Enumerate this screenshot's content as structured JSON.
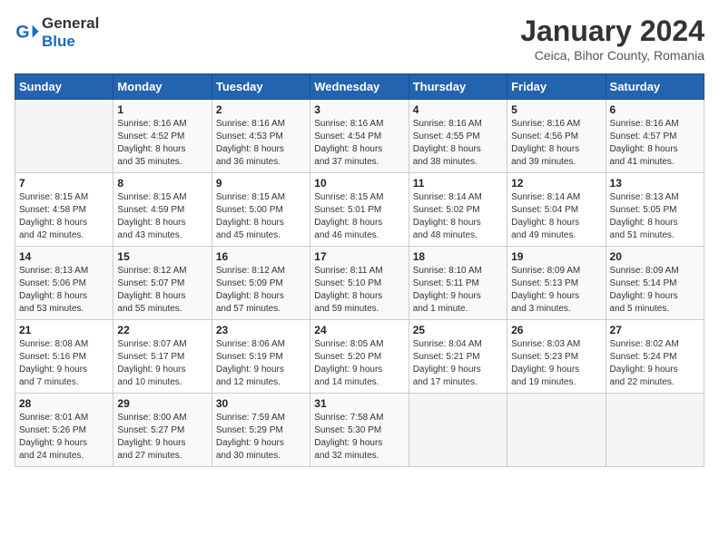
{
  "header": {
    "logo_general": "General",
    "logo_blue": "Blue",
    "title": "January 2024",
    "subtitle": "Ceica, Bihor County, Romania"
  },
  "weekdays": [
    "Sunday",
    "Monday",
    "Tuesday",
    "Wednesday",
    "Thursday",
    "Friday",
    "Saturday"
  ],
  "weeks": [
    [
      {
        "day": "",
        "info": ""
      },
      {
        "day": "1",
        "info": "Sunrise: 8:16 AM\nSunset: 4:52 PM\nDaylight: 8 hours\nand 35 minutes."
      },
      {
        "day": "2",
        "info": "Sunrise: 8:16 AM\nSunset: 4:53 PM\nDaylight: 8 hours\nand 36 minutes."
      },
      {
        "day": "3",
        "info": "Sunrise: 8:16 AM\nSunset: 4:54 PM\nDaylight: 8 hours\nand 37 minutes."
      },
      {
        "day": "4",
        "info": "Sunrise: 8:16 AM\nSunset: 4:55 PM\nDaylight: 8 hours\nand 38 minutes."
      },
      {
        "day": "5",
        "info": "Sunrise: 8:16 AM\nSunset: 4:56 PM\nDaylight: 8 hours\nand 39 minutes."
      },
      {
        "day": "6",
        "info": "Sunrise: 8:16 AM\nSunset: 4:57 PM\nDaylight: 8 hours\nand 41 minutes."
      }
    ],
    [
      {
        "day": "7",
        "info": "Sunrise: 8:15 AM\nSunset: 4:58 PM\nDaylight: 8 hours\nand 42 minutes."
      },
      {
        "day": "8",
        "info": "Sunrise: 8:15 AM\nSunset: 4:59 PM\nDaylight: 8 hours\nand 43 minutes."
      },
      {
        "day": "9",
        "info": "Sunrise: 8:15 AM\nSunset: 5:00 PM\nDaylight: 8 hours\nand 45 minutes."
      },
      {
        "day": "10",
        "info": "Sunrise: 8:15 AM\nSunset: 5:01 PM\nDaylight: 8 hours\nand 46 minutes."
      },
      {
        "day": "11",
        "info": "Sunrise: 8:14 AM\nSunset: 5:02 PM\nDaylight: 8 hours\nand 48 minutes."
      },
      {
        "day": "12",
        "info": "Sunrise: 8:14 AM\nSunset: 5:04 PM\nDaylight: 8 hours\nand 49 minutes."
      },
      {
        "day": "13",
        "info": "Sunrise: 8:13 AM\nSunset: 5:05 PM\nDaylight: 8 hours\nand 51 minutes."
      }
    ],
    [
      {
        "day": "14",
        "info": "Sunrise: 8:13 AM\nSunset: 5:06 PM\nDaylight: 8 hours\nand 53 minutes."
      },
      {
        "day": "15",
        "info": "Sunrise: 8:12 AM\nSunset: 5:07 PM\nDaylight: 8 hours\nand 55 minutes."
      },
      {
        "day": "16",
        "info": "Sunrise: 8:12 AM\nSunset: 5:09 PM\nDaylight: 8 hours\nand 57 minutes."
      },
      {
        "day": "17",
        "info": "Sunrise: 8:11 AM\nSunset: 5:10 PM\nDaylight: 8 hours\nand 59 minutes."
      },
      {
        "day": "18",
        "info": "Sunrise: 8:10 AM\nSunset: 5:11 PM\nDaylight: 9 hours\nand 1 minute."
      },
      {
        "day": "19",
        "info": "Sunrise: 8:09 AM\nSunset: 5:13 PM\nDaylight: 9 hours\nand 3 minutes."
      },
      {
        "day": "20",
        "info": "Sunrise: 8:09 AM\nSunset: 5:14 PM\nDaylight: 9 hours\nand 5 minutes."
      }
    ],
    [
      {
        "day": "21",
        "info": "Sunrise: 8:08 AM\nSunset: 5:16 PM\nDaylight: 9 hours\nand 7 minutes."
      },
      {
        "day": "22",
        "info": "Sunrise: 8:07 AM\nSunset: 5:17 PM\nDaylight: 9 hours\nand 10 minutes."
      },
      {
        "day": "23",
        "info": "Sunrise: 8:06 AM\nSunset: 5:19 PM\nDaylight: 9 hours\nand 12 minutes."
      },
      {
        "day": "24",
        "info": "Sunrise: 8:05 AM\nSunset: 5:20 PM\nDaylight: 9 hours\nand 14 minutes."
      },
      {
        "day": "25",
        "info": "Sunrise: 8:04 AM\nSunset: 5:21 PM\nDaylight: 9 hours\nand 17 minutes."
      },
      {
        "day": "26",
        "info": "Sunrise: 8:03 AM\nSunset: 5:23 PM\nDaylight: 9 hours\nand 19 minutes."
      },
      {
        "day": "27",
        "info": "Sunrise: 8:02 AM\nSunset: 5:24 PM\nDaylight: 9 hours\nand 22 minutes."
      }
    ],
    [
      {
        "day": "28",
        "info": "Sunrise: 8:01 AM\nSunset: 5:26 PM\nDaylight: 9 hours\nand 24 minutes."
      },
      {
        "day": "29",
        "info": "Sunrise: 8:00 AM\nSunset: 5:27 PM\nDaylight: 9 hours\nand 27 minutes."
      },
      {
        "day": "30",
        "info": "Sunrise: 7:59 AM\nSunset: 5:29 PM\nDaylight: 9 hours\nand 30 minutes."
      },
      {
        "day": "31",
        "info": "Sunrise: 7:58 AM\nSunset: 5:30 PM\nDaylight: 9 hours\nand 32 minutes."
      },
      {
        "day": "",
        "info": ""
      },
      {
        "day": "",
        "info": ""
      },
      {
        "day": "",
        "info": ""
      }
    ]
  ]
}
